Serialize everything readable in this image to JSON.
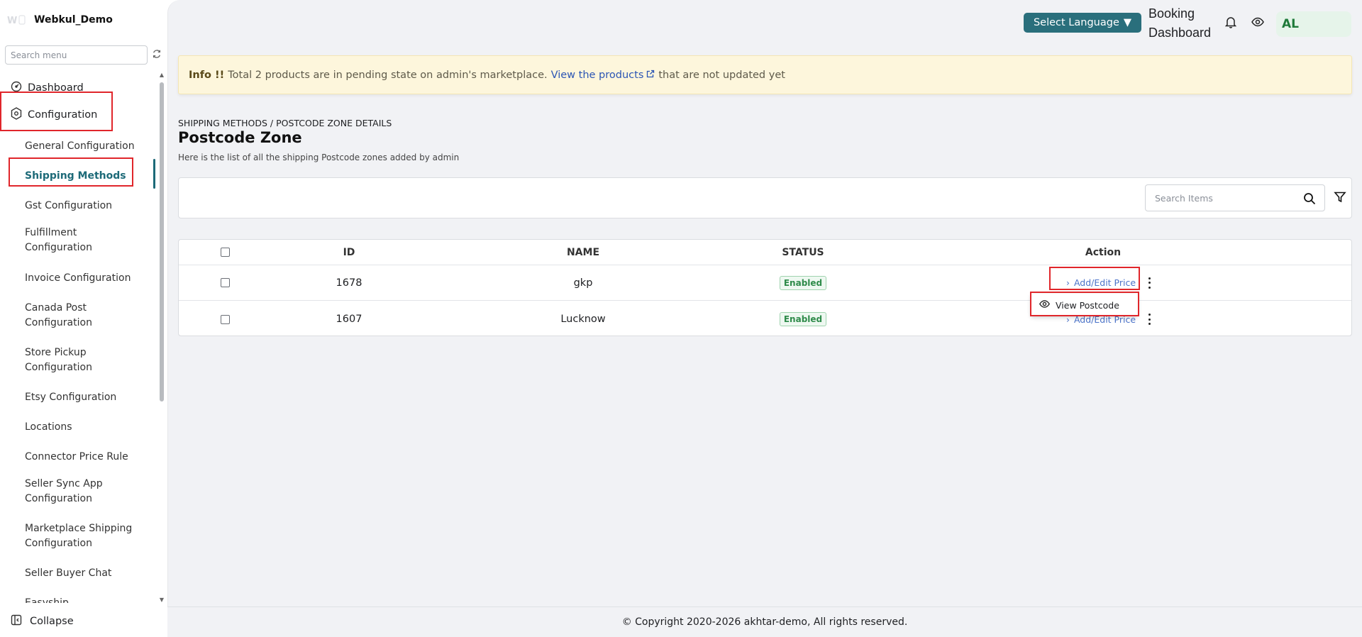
{
  "app": {
    "brand_name": "Webkul_Demo"
  },
  "sidebar": {
    "search_placeholder": "Search menu",
    "items": [
      {
        "label": "Dashboard",
        "icon": "dashboard-icon"
      },
      {
        "label": "Configuration",
        "icon": "hexagon-gear-icon"
      }
    ],
    "sub_items": [
      {
        "label": "General Configuration"
      },
      {
        "label": "Shipping Methods",
        "active": true
      },
      {
        "label": "Gst Configuration"
      },
      {
        "label": "Fulfillment Configuration"
      },
      {
        "label": "Invoice Configuration"
      },
      {
        "label": "Canada Post Configuration"
      },
      {
        "label": "Store Pickup Configuration"
      },
      {
        "label": "Etsy Configuration"
      },
      {
        "label": "Locations"
      },
      {
        "label": "Connector Price Rule"
      },
      {
        "label": "Seller Sync App Configuration"
      },
      {
        "label": "Marketplace Shipping Configuration"
      },
      {
        "label": "Seller Buyer Chat"
      },
      {
        "label": "Easyship"
      }
    ],
    "collapse_label": "Collapse"
  },
  "header": {
    "language_button": "Select Language",
    "booking_dashboard": "Booking Dashboard",
    "avatar_initials": "AL"
  },
  "info_banner": {
    "prefix": "Info !!",
    "text": "Total 2 products are in pending state on admin's marketplace.",
    "link_text": "View the products",
    "suffix": "that are not updated yet"
  },
  "page": {
    "breadcrumb": "SHIPPING METHODS / POSTCODE ZONE DETAILS",
    "title": "Postcode Zone",
    "subtitle": "Here is the list of all the shipping Postcode zones added by admin"
  },
  "search": {
    "placeholder": "Search Items"
  },
  "table": {
    "headers": {
      "id": "ID",
      "name": "NAME",
      "status": "STATUS",
      "action": "Action"
    },
    "rows": [
      {
        "id": "1678",
        "name": "gkp",
        "status": "Enabled",
        "action": "Add/Edit Price"
      },
      {
        "id": "1607",
        "name": "Lucknow",
        "status": "Enabled",
        "action": "Add/Edit Price"
      }
    ]
  },
  "popup": {
    "label": "View Postcode"
  },
  "footer": {
    "copyright": "© Copyright 2020-2026 akhtar-demo, All rights reserved."
  },
  "colors": {
    "accent": "#2a6f7c",
    "active_text": "#1d6a78",
    "highlight": "#e0262b",
    "status_green": "#2e8b4a",
    "link": "#4b73c9"
  }
}
